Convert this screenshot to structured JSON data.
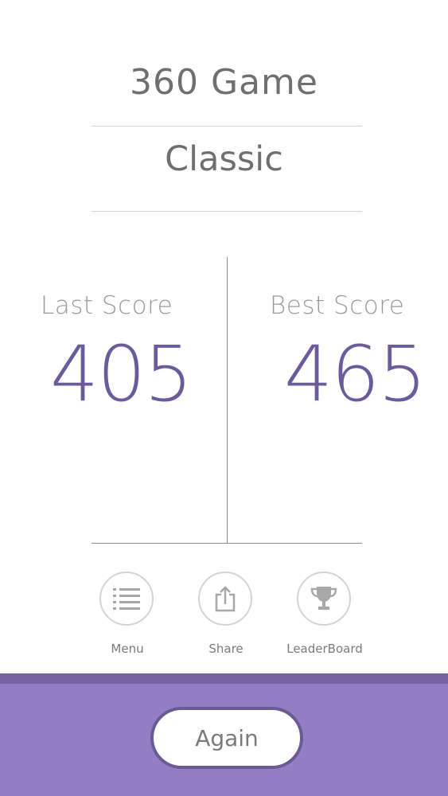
{
  "header": {
    "title": "360 Game",
    "mode": "Classic"
  },
  "scores": {
    "last_label": "Last Score",
    "last_value": "405",
    "best_label": "Best Score",
    "best_value": "465"
  },
  "actions": {
    "menu": {
      "label": "Menu",
      "icon": "menu-icon"
    },
    "share": {
      "label": "Share",
      "icon": "share-icon"
    },
    "leaderboard": {
      "label": "LeaderBoard",
      "icon": "trophy-icon"
    }
  },
  "footer": {
    "again_label": "Again"
  },
  "colors": {
    "accent": "#957dc4",
    "accent_dark": "#6a5a96",
    "score": "#6a5c9c"
  }
}
